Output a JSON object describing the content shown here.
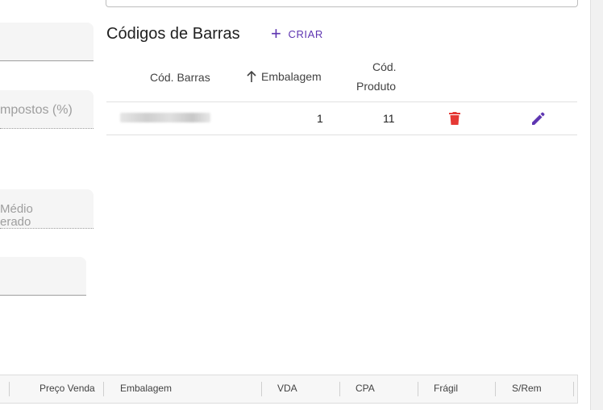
{
  "left_form": {
    "field_impostos_label": "mpostos (%)",
    "field_medio_label_line1": " Médio",
    "field_medio_label_line2": "erado"
  },
  "barcodes": {
    "title": "Códigos de Barras",
    "create_label": "CRIAR",
    "columns": {
      "cod_barras": "Cód. Barras",
      "embalagem": "Embalagem",
      "cod_produto_line1": "Cód.",
      "cod_produto_line2": "Produto"
    },
    "rows": [
      {
        "cod_barras": "",
        "embalagem": "1",
        "cod_produto": "11"
      }
    ],
    "colors": {
      "accent": "#5e35b1",
      "delete": "#e53935"
    }
  },
  "grid": {
    "columns": [
      "Preço Venda",
      "Embalagem",
      "VDA",
      "CPA",
      "Frágil",
      "S/Rem"
    ]
  }
}
